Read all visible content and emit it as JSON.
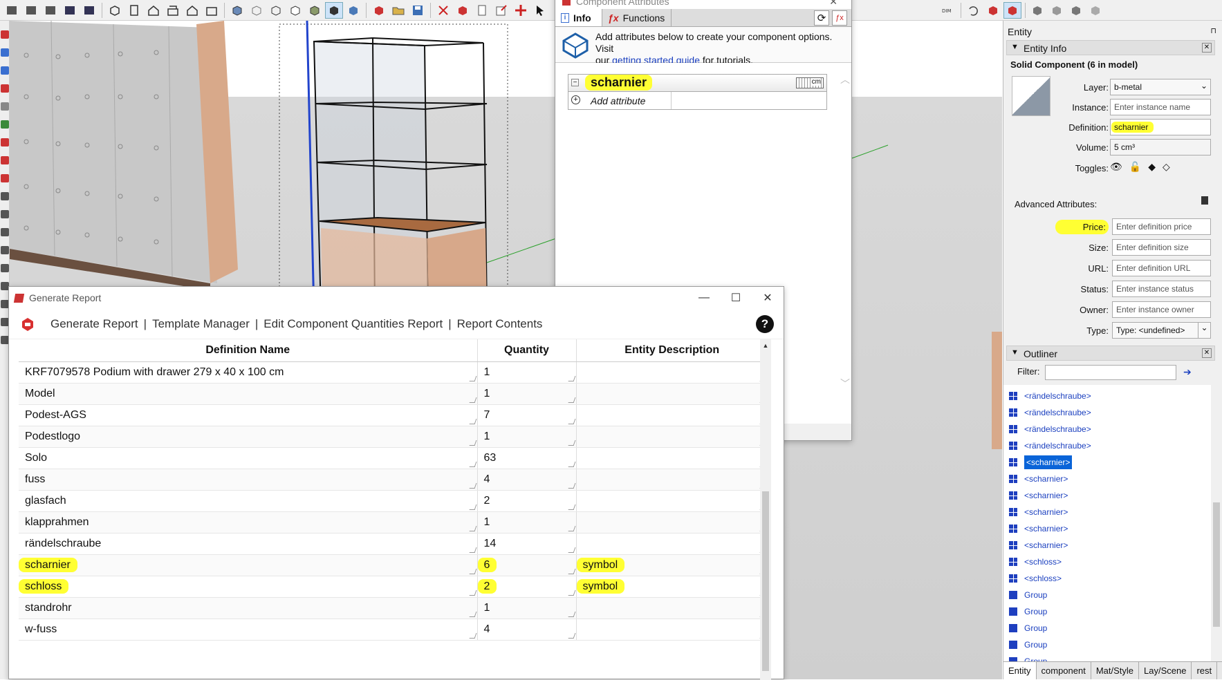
{
  "component_attributes": {
    "title": "Component Attributes",
    "tab_info": "Info",
    "tab_functions": "Functions",
    "help_text_1": "Add attributes below to create your component options. Visit",
    "help_text_2_pre": "our",
    "help_link": "getting started guide",
    "help_text_2_post": "for tutorials.",
    "component_name": "scharnier",
    "units": "cm",
    "add_attribute": "Add attribute"
  },
  "report": {
    "title": "Generate Report",
    "nav": [
      "Generate Report",
      "Template Manager",
      "Edit Component Quantities Report",
      "Report Contents"
    ],
    "help_label": "?",
    "columns": [
      "Definition Name",
      "Quantity",
      "Entity Description"
    ],
    "rows": [
      {
        "name": "KRF7079578 Podium with drawer 279 x 40 x 100 cm",
        "qty": "1",
        "desc": ""
      },
      {
        "name": "Model",
        "qty": "1",
        "desc": ""
      },
      {
        "name": "Podest-AGS",
        "qty": "7",
        "desc": ""
      },
      {
        "name": "Podestlogo",
        "qty": "1",
        "desc": ""
      },
      {
        "name": "Solo",
        "qty": "63",
        "desc": ""
      },
      {
        "name": "fuss",
        "qty": "4",
        "desc": ""
      },
      {
        "name": "glasfach",
        "qty": "2",
        "desc": ""
      },
      {
        "name": "klapprahmen",
        "qty": "1",
        "desc": ""
      },
      {
        "name": "rändelschraube",
        "qty": "14",
        "desc": ""
      },
      {
        "name": "scharnier",
        "qty": "6",
        "desc": "symbol",
        "highlight": true
      },
      {
        "name": "schloss",
        "qty": "2",
        "desc": "symbol",
        "highlight": true
      },
      {
        "name": "standrohr",
        "qty": "1",
        "desc": ""
      },
      {
        "name": "w-fuss",
        "qty": "4",
        "desc": ""
      }
    ]
  },
  "entity_panel": {
    "header": "Entity",
    "section_title": "Entity Info",
    "subtitle": "Solid Component (6 in model)",
    "layer_label": "Layer:",
    "layer_value": "b-metal",
    "instance_label": "Instance:",
    "instance_placeholder": "Enter instance name",
    "definition_label": "Definition:",
    "definition_value": "scharnier",
    "volume_label": "Volume:",
    "volume_value": "5 cm³",
    "toggles_label": "Toggles:",
    "advanced_label": "Advanced Attributes:",
    "price_label": "Price:",
    "price_placeholder": "Enter definition price",
    "size_label": "Size:",
    "size_placeholder": "Enter definition size",
    "url_label": "URL:",
    "url_placeholder": "Enter definition URL",
    "status_label": "Status:",
    "status_placeholder": "Enter instance status",
    "owner_label": "Owner:",
    "owner_placeholder": "Enter instance owner",
    "type_label": "Type:",
    "type_value": "Type: <undefined>",
    "outliner_title": "Outliner",
    "filter_label": "Filter:",
    "outliner_items": [
      {
        "label": "<rändelschraube>",
        "kind": "component"
      },
      {
        "label": "<rändelschraube>",
        "kind": "component"
      },
      {
        "label": "<rändelschraube>",
        "kind": "component"
      },
      {
        "label": "<rändelschraube>",
        "kind": "component"
      },
      {
        "label": "<scharnier>",
        "kind": "component",
        "selected": true
      },
      {
        "label": "<scharnier>",
        "kind": "component"
      },
      {
        "label": "<scharnier>",
        "kind": "component"
      },
      {
        "label": "<scharnier>",
        "kind": "component"
      },
      {
        "label": "<scharnier>",
        "kind": "component"
      },
      {
        "label": "<scharnier>",
        "kind": "component"
      },
      {
        "label": "<schloss>",
        "kind": "component"
      },
      {
        "label": "<schloss>",
        "kind": "component"
      },
      {
        "label": "Group",
        "kind": "group"
      },
      {
        "label": "Group",
        "kind": "group"
      },
      {
        "label": "Group",
        "kind": "group"
      },
      {
        "label": "Group",
        "kind": "group"
      },
      {
        "label": "Group",
        "kind": "group"
      }
    ],
    "bottom_tabs": [
      "Entity",
      "component",
      "Mat/Style",
      "Lay/Scene",
      "rest"
    ]
  },
  "colors": {
    "highlight": "#ffff33",
    "selected": "#0a64d8",
    "link": "#1a3fbf"
  }
}
